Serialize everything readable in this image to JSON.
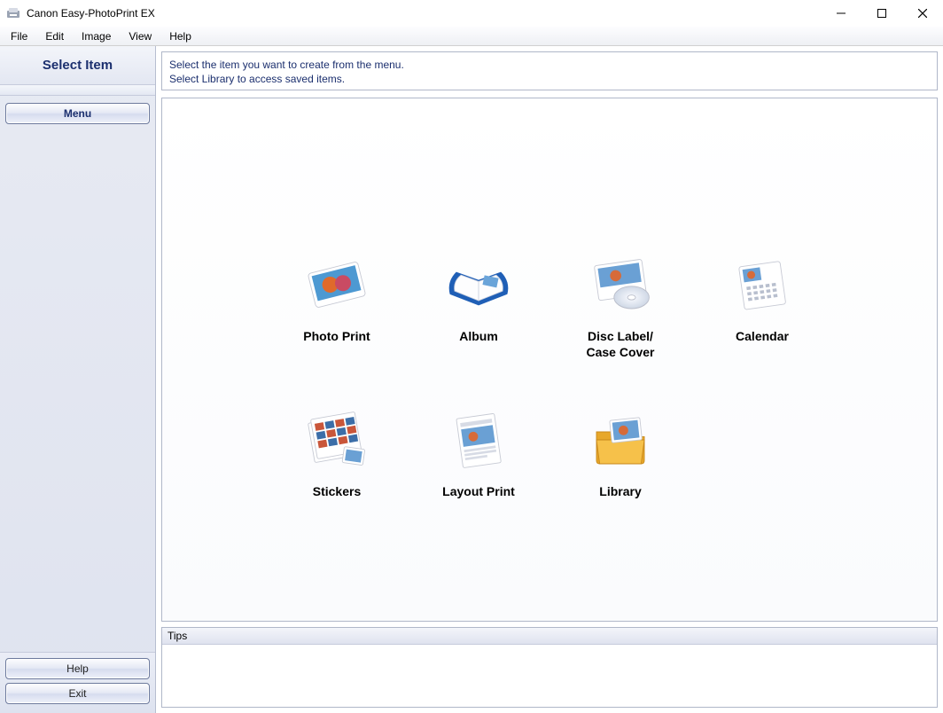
{
  "window": {
    "title": "Canon Easy-PhotoPrint EX"
  },
  "menubar": {
    "items": [
      {
        "label": "File"
      },
      {
        "label": "Edit"
      },
      {
        "label": "Image"
      },
      {
        "label": "View"
      },
      {
        "label": "Help"
      }
    ]
  },
  "sidebar": {
    "title": "Select Item",
    "menu_button": "Menu",
    "help_button": "Help",
    "exit_button": "Exit"
  },
  "info": {
    "line1": "Select the item you want to create from the menu.",
    "line2": "Select Library to access saved items."
  },
  "tiles": [
    {
      "label": "Photo Print"
    },
    {
      "label": "Album"
    },
    {
      "label": "Disc Label/\nCase Cover"
    },
    {
      "label": "Calendar"
    },
    {
      "label": "Stickers"
    },
    {
      "label": "Layout Print"
    },
    {
      "label": "Library"
    }
  ],
  "tips": {
    "header": "Tips"
  }
}
